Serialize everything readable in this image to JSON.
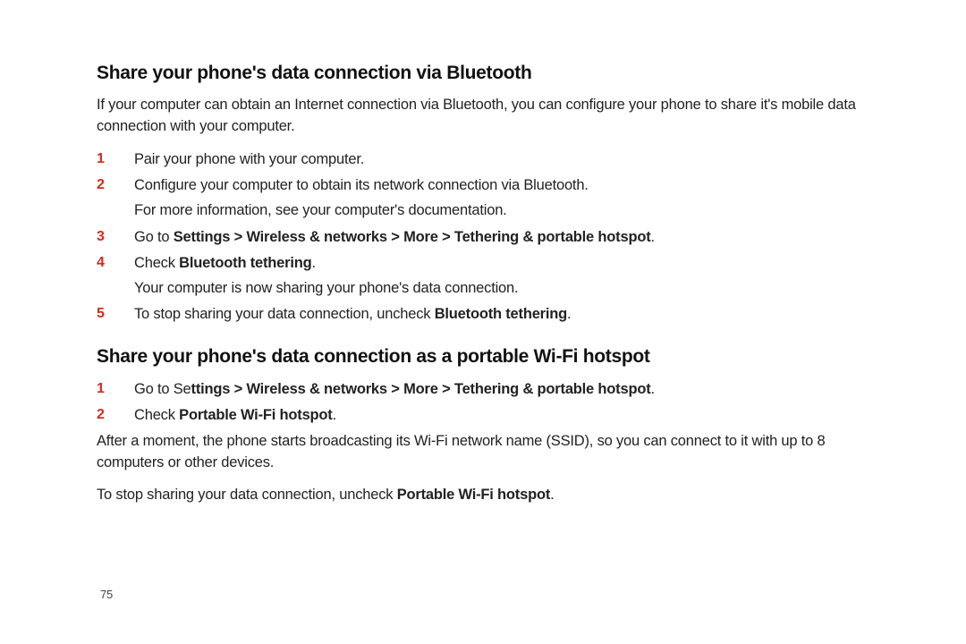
{
  "section1": {
    "heading": "Share your phone's data connection via Bluetooth",
    "intro": "If your computer can obtain an Internet connection via Bluetooth, you can configure your phone to share it's mobile data connection with your computer.",
    "step1_num": "1",
    "step1_text": "Pair your phone with your computer.",
    "step2_num": "2",
    "step2_text": "Configure your computer to obtain its network connection via Bluetooth.",
    "step2_sub": "For more information, see your computer's documentation.",
    "step3_num": "3",
    "step3_pre": "Go to ",
    "step3_bold": "Settings > Wireless & networks > More > Tethering & portable hotspot",
    "step3_post": ".",
    "step4_num": "4",
    "step4_pre": "Check ",
    "step4_bold": "Bluetooth tethering",
    "step4_post": ".",
    "step4_sub": "Your computer is now sharing your phone's data connection.",
    "step5_num": "5",
    "step5_pre": "To stop sharing your data connection, uncheck ",
    "step5_bold": "Bluetooth tethering",
    "step5_post": "."
  },
  "section2": {
    "heading": "Share your phone's data connection as a portable Wi-Fi hotspot",
    "step1_num": "1",
    "step1_pre": "Go to Se",
    "step1_bold": "ttings > Wireless & networks > More > Tethering & portable hotspot",
    "step1_post": ".",
    "step2_num": "2",
    "step2_pre": "Check ",
    "step2_bold": "Portable Wi-Fi hotspot",
    "step2_post": ".",
    "para1": "After a moment, the phone starts broadcasting its Wi-Fi network name (SSID), so you can connect to it with up to 8 computers or other devices.",
    "para2_pre": "To stop sharing your data connection, uncheck ",
    "para2_bold": "Portable Wi-Fi hotspot",
    "para2_post": "."
  },
  "page_number": "75"
}
